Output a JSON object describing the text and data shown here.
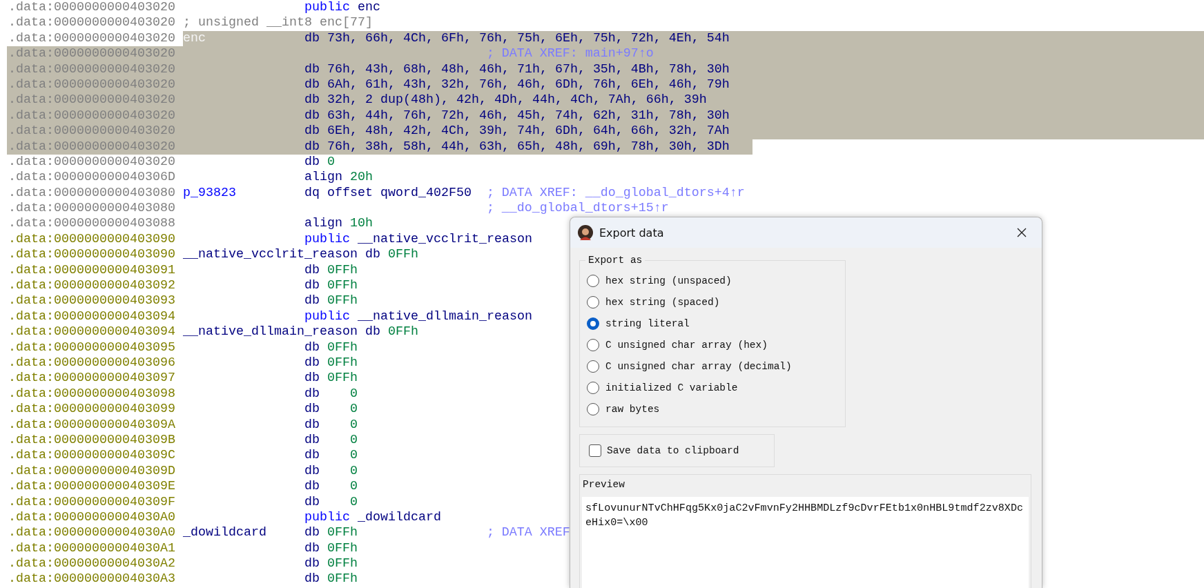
{
  "listing": [
    {
      "address": ".data:0000000000403020",
      "color": "#808080",
      "selected": false,
      "kind": "directive",
      "mnemonic": "public",
      "operand": "enc"
    },
    {
      "address": ".data:0000000000403020",
      "color": "#808080",
      "selected": false,
      "kind": "note",
      "comment": "; unsigned __int8 enc[77]"
    },
    {
      "address": ".data:0000000000403020",
      "color": "#808080",
      "selected": true,
      "label": "enc",
      "kind": "data",
      "mnemonic": "db",
      "operand": "73h, 66h, 4Ch, 6Fh, 76h, 75h, 6Eh, 75h, 72h, 4Eh, 54h"
    },
    {
      "address": ".data:0000000000403020",
      "color": "#808080",
      "selected": true,
      "kind": "xref",
      "comment": "; DATA XREF: main+97↑o"
    },
    {
      "address": ".data:0000000000403020",
      "color": "#808080",
      "selected": true,
      "kind": "data",
      "mnemonic": "db",
      "operand": "76h, 43h, 68h, 48h, 46h, 71h, 67h, 35h, 4Bh, 78h, 30h"
    },
    {
      "address": ".data:0000000000403020",
      "color": "#808080",
      "selected": true,
      "kind": "data",
      "mnemonic": "db",
      "operand": "6Ah, 61h, 43h, 32h, 76h, 46h, 6Dh, 76h, 6Eh, 46h, 79h"
    },
    {
      "address": ".data:0000000000403020",
      "color": "#808080",
      "selected": true,
      "kind": "data",
      "mnemonic": "db",
      "operand": "32h, 2 dup(48h), 42h, 4Dh, 44h, 4Ch, 7Ah, 66h, 39h"
    },
    {
      "address": ".data:0000000000403020",
      "color": "#808080",
      "selected": true,
      "kind": "data",
      "mnemonic": "db",
      "operand": "63h, 44h, 76h, 72h, 46h, 45h, 74h, 62h, 31h, 78h, 30h"
    },
    {
      "address": ".data:0000000000403020",
      "color": "#808080",
      "selected": true,
      "kind": "data",
      "mnemonic": "db",
      "operand": "6Eh, 48h, 42h, 4Ch, 39h, 74h, 6Dh, 64h, 66h, 32h, 7Ah"
    },
    {
      "address": ".data:0000000000403020",
      "color": "#808080",
      "selected": true,
      "kind": "data",
      "mnemonic": "db",
      "operand": "76h, 38h, 58h, 44h, 63h, 65h, 48h, 69h, 78h, 30h, 3Dh"
    },
    {
      "address": ".data:0000000000403020",
      "color": "#808080",
      "selected": false,
      "kind": "data",
      "mnemonic": "db",
      "operand": "0"
    },
    {
      "address": ".data:000000000040306D",
      "color": "#808080",
      "selected": false,
      "kind": "data",
      "mnemonic": "align",
      "operand": "20h"
    },
    {
      "address": ".data:0000000000403080",
      "color": "#808080",
      "selected": false,
      "label": "p_93823",
      "kind": "pointer",
      "mnemonic": "dq",
      "operand": "offset qword_402F50",
      "comment": "; DATA XREF: __do_global_dtors+4↑r"
    },
    {
      "address": ".data:0000000000403080",
      "color": "#808080",
      "selected": false,
      "kind": "xref",
      "comment": "; __do_global_dtors+15↑r"
    },
    {
      "address": ".data:0000000000403088",
      "color": "#808080",
      "selected": false,
      "kind": "data",
      "mnemonic": "align",
      "operand": "10h"
    },
    {
      "address": ".data:0000000000403090",
      "color": "#808000",
      "selected": false,
      "kind": "directive",
      "mnemonic": "public",
      "operand": "__native_vcclrit_reason"
    },
    {
      "address": ".data:0000000000403090",
      "color": "#808000",
      "selected": false,
      "label": "__native_vcclrit_reason",
      "kind": "data",
      "mnemonic": "db",
      "operand": "0FFh"
    },
    {
      "address": ".data:0000000000403091",
      "color": "#808000",
      "selected": false,
      "kind": "data",
      "mnemonic": "db",
      "operand": "0FFh"
    },
    {
      "address": ".data:0000000000403092",
      "color": "#808000",
      "selected": false,
      "kind": "data",
      "mnemonic": "db",
      "operand": "0FFh"
    },
    {
      "address": ".data:0000000000403093",
      "color": "#808000",
      "selected": false,
      "kind": "data",
      "mnemonic": "db",
      "operand": "0FFh"
    },
    {
      "address": ".data:0000000000403094",
      "color": "#808000",
      "selected": false,
      "kind": "directive",
      "mnemonic": "public",
      "operand": "__native_dllmain_reason"
    },
    {
      "address": ".data:0000000000403094",
      "color": "#808000",
      "selected": false,
      "label": "__native_dllmain_reason",
      "kind": "data",
      "mnemonic": "db",
      "operand": "0FFh"
    },
    {
      "address": ".data:0000000000403095",
      "color": "#808000",
      "selected": false,
      "kind": "data",
      "mnemonic": "db",
      "operand": "0FFh"
    },
    {
      "address": ".data:0000000000403096",
      "color": "#808000",
      "selected": false,
      "kind": "data",
      "mnemonic": "db",
      "operand": "0FFh"
    },
    {
      "address": ".data:0000000000403097",
      "color": "#808000",
      "selected": false,
      "kind": "data",
      "mnemonic": "db",
      "operand": "0FFh"
    },
    {
      "address": ".data:0000000000403098",
      "color": "#808000",
      "selected": false,
      "kind": "data",
      "mnemonic": "db",
      "operand": "   0"
    },
    {
      "address": ".data:0000000000403099",
      "color": "#808000",
      "selected": false,
      "kind": "data",
      "mnemonic": "db",
      "operand": "   0"
    },
    {
      "address": ".data:000000000040309A",
      "color": "#808000",
      "selected": false,
      "kind": "data",
      "mnemonic": "db",
      "operand": "   0"
    },
    {
      "address": ".data:000000000040309B",
      "color": "#808000",
      "selected": false,
      "kind": "data",
      "mnemonic": "db",
      "operand": "   0"
    },
    {
      "address": ".data:000000000040309C",
      "color": "#808000",
      "selected": false,
      "kind": "data",
      "mnemonic": "db",
      "operand": "   0"
    },
    {
      "address": ".data:000000000040309D",
      "color": "#808000",
      "selected": false,
      "kind": "data",
      "mnemonic": "db",
      "operand": "   0"
    },
    {
      "address": ".data:000000000040309E",
      "color": "#808000",
      "selected": false,
      "kind": "data",
      "mnemonic": "db",
      "operand": "   0"
    },
    {
      "address": ".data:000000000040309F",
      "color": "#808000",
      "selected": false,
      "kind": "data",
      "mnemonic": "db",
      "operand": "   0"
    },
    {
      "address": ".data:00000000004030A0",
      "color": "#808000",
      "selected": false,
      "kind": "directive",
      "mnemonic": "public",
      "operand": "_dowildcard"
    },
    {
      "address": ".data:00000000004030A0",
      "color": "#808000",
      "selected": false,
      "label": "_dowildcard",
      "kind": "data",
      "mnemonic": "db",
      "operand": "0FFh",
      "comment": "; DATA XREF"
    },
    {
      "address": ".data:00000000004030A1",
      "color": "#808000",
      "selected": false,
      "kind": "data",
      "mnemonic": "db",
      "operand": "0FFh"
    },
    {
      "address": ".data:00000000004030A2",
      "color": "#808000",
      "selected": false,
      "kind": "data",
      "mnemonic": "db",
      "operand": "0FFh"
    },
    {
      "address": ".data:00000000004030A3",
      "color": "#808000",
      "selected": false,
      "kind": "data",
      "mnemonic": "db",
      "operand": "0FFh"
    }
  ],
  "dialog": {
    "title": "Export data",
    "export_as": {
      "legend": "Export as",
      "options": [
        {
          "label": "hex string (unspaced)",
          "selected": false
        },
        {
          "label": "hex string (spaced)",
          "selected": false
        },
        {
          "label": "string literal",
          "selected": true
        },
        {
          "label": "C unsigned char array (hex)",
          "selected": false
        },
        {
          "label": "C unsigned char array (decimal)",
          "selected": false
        },
        {
          "label": "initialized C variable",
          "selected": false
        },
        {
          "label": "raw bytes",
          "selected": false
        }
      ]
    },
    "save_to_clipboard": {
      "label": "Save data to clipboard",
      "checked": false
    },
    "preview": {
      "legend": "Preview",
      "text": "sfLovunurNTvChHFqg5Kx0jaC2vFmvnFy2HHBMDLzf9cDvrFEtb1x0nHBL9tmdf2zv8XDceHix0=\\x00"
    }
  }
}
